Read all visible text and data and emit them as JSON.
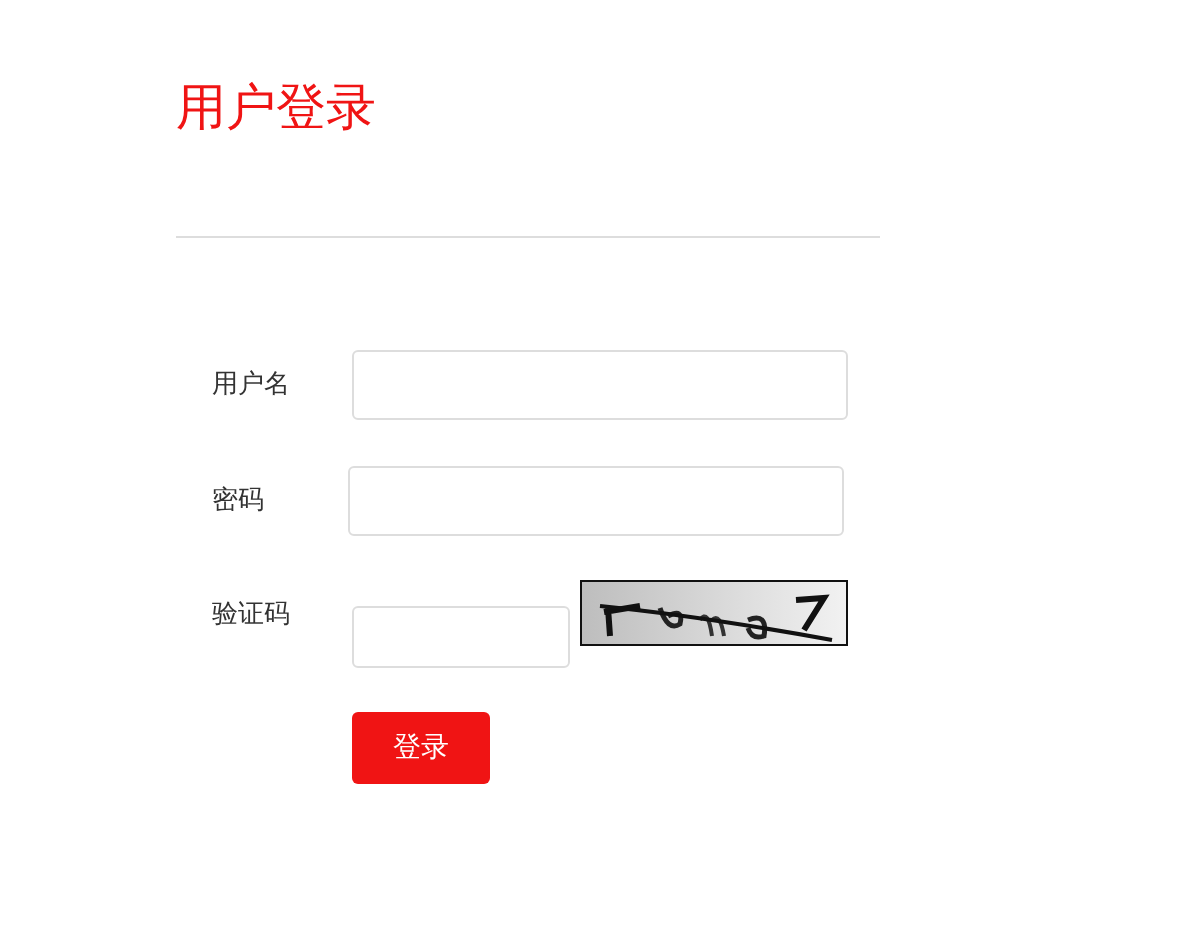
{
  "title": "用户登录",
  "fields": [
    {
      "label": "用户名",
      "kind": "text"
    },
    {
      "label": "密码",
      "kind": "password"
    },
    {
      "label": "验证码",
      "kind": "captcha"
    }
  ],
  "submit": "登录"
}
